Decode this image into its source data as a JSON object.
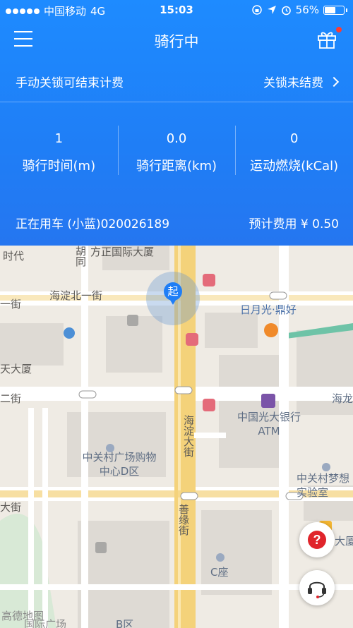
{
  "status_bar": {
    "carrier": "中国移动",
    "network": "4G",
    "time": "15:03",
    "battery": "56%"
  },
  "nav": {
    "title": "骑行中"
  },
  "lock_row": {
    "hint": "手动关锁可结束计费",
    "link": "关锁未结费"
  },
  "stats": [
    {
      "value": "1",
      "label": "骑行时间(m)"
    },
    {
      "value": "0.0",
      "label": "骑行距离(km)"
    },
    {
      "value": "0",
      "label": "运动燃烧(kCal)"
    }
  ],
  "usage": {
    "using": "正在用车 (小蓝)020026189",
    "fee": "预计费用 ¥ 0.50"
  },
  "map": {
    "start_marker": "起",
    "labels": {
      "shidai": "时代",
      "hutong": "胡同",
      "fangzheng": "方正国际大厦",
      "haidian_n1": "海淀北一街",
      "yieji": "一街",
      "riyueguang": "日月光·鼎好",
      "tiandasha": "天大厦",
      "erjie": "二街",
      "everbright": "中国光大银行ATM",
      "hai": "海龙",
      "haidian_da": "海淀大街",
      "zgc_d": "中关村广场购物中心D区",
      "zgc_dream": "中关村梦想实验室",
      "dajie": "大街",
      "shanyuan": "善缘街",
      "dasha": "大厦",
      "c_zuo": "C座",
      "gaode": "高德地图",
      "guangchang": "国际广场",
      "b_qu": "B区"
    }
  },
  "help_icon_text": "?",
  "colors": {
    "header_blue": "#1f7ef6",
    "road_yellow": "#f4d27a",
    "help_red": "#e0242b"
  }
}
